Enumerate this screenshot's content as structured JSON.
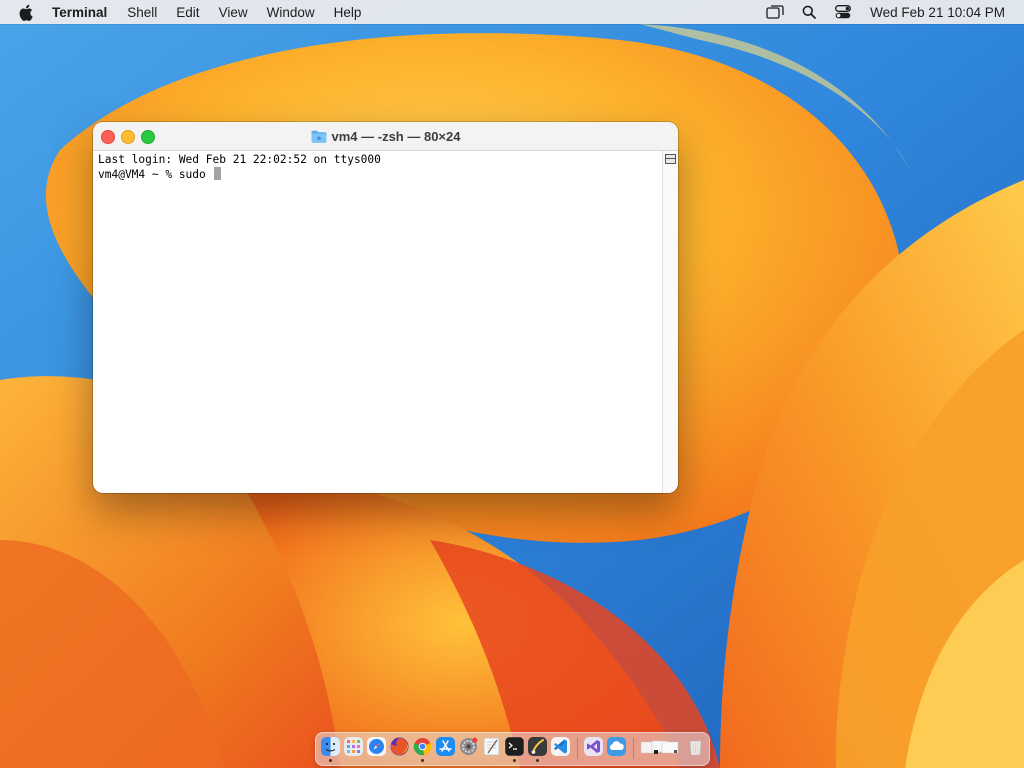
{
  "menubar": {
    "app_name": "Terminal",
    "menus": [
      "Shell",
      "Edit",
      "View",
      "Window",
      "Help"
    ],
    "icons": [
      "apple-logo",
      "screen-mirroring",
      "spotlight-search",
      "control-center"
    ],
    "clock": "Wed Feb 21  10:04 PM"
  },
  "window": {
    "title": "vm4 — -zsh — 80×24",
    "lines": [
      "Last login: Wed Feb 21 22:02:52 on ttys000",
      "vm4@VM4 ~ % sudo "
    ]
  },
  "dock": {
    "apps": [
      {
        "name": "Finder",
        "icon": "finder",
        "color": "#3b8cf0",
        "running": true
      },
      {
        "name": "Launchpad",
        "icon": "launchpad",
        "color": "#e9e9ee",
        "running": false
      },
      {
        "name": "Safari",
        "icon": "safari",
        "color": "#2a83f0",
        "running": false
      },
      {
        "name": "Firefox",
        "icon": "firefox",
        "color": "#e8562a",
        "running": false
      },
      {
        "name": "Chrome",
        "icon": "chrome",
        "color": "#f2f2f2",
        "running": true
      },
      {
        "name": "App Store",
        "icon": "app-store",
        "color": "#1e8cf5",
        "running": false
      },
      {
        "name": "System Settings",
        "icon": "settings",
        "color": "#8a8a8e",
        "running": false
      },
      {
        "name": "TextEdit",
        "icon": "textedit",
        "color": "#f7f7f7",
        "running": false
      },
      {
        "name": "Terminal",
        "icon": "terminal",
        "color": "#1e1e1e",
        "running": true
      },
      {
        "name": "Script Editor",
        "icon": "script-editor",
        "color": "#3a3a3a",
        "running": true
      },
      {
        "name": "Visual Studio Code",
        "icon": "vscode",
        "color": "#2c8ee0",
        "running": false
      },
      {
        "name": "Visual Studio",
        "icon": "visual-studio",
        "color": "#e9e3f6",
        "running": false
      },
      {
        "name": "Cloud App",
        "icon": "cloud",
        "color": "#3f9ae6",
        "running": false
      },
      {
        "name": "Downloads",
        "icon": "downloads",
        "color": "#f0f0f0",
        "running": false
      },
      {
        "name": "Trash",
        "icon": "trash",
        "color": "#d4d4d4",
        "running": false
      }
    ]
  }
}
